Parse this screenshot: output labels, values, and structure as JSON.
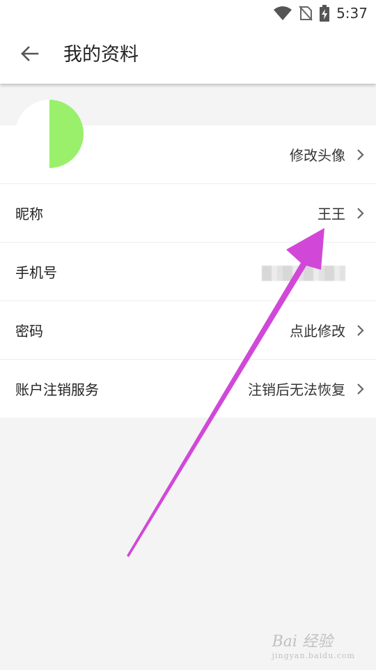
{
  "status_bar": {
    "time": "5:37",
    "icons": [
      "wifi-icon",
      "no-sim-icon",
      "battery-charging-icon"
    ]
  },
  "app_bar": {
    "back_icon": "arrow-left-icon",
    "title": "我的资料"
  },
  "profile": {
    "avatar_colors": {
      "left": "#ffffff",
      "right": "#9af06a"
    },
    "rows": [
      {
        "label": "",
        "value": "修改头像",
        "chevron": true
      },
      {
        "label": "昵称",
        "value": "王王",
        "chevron": true
      },
      {
        "label": "手机号",
        "value": "",
        "masked": true,
        "chevron": false
      },
      {
        "label": "密码",
        "value": "点此修改",
        "chevron": true
      },
      {
        "label": "账户注销服务",
        "value": "注销后无法恢复",
        "chevron": true
      }
    ]
  },
  "annotation": {
    "arrow_color": "#d148d8"
  },
  "watermark": {
    "brand": "Bai 经验",
    "sub": "jingyan.baidu.com"
  }
}
